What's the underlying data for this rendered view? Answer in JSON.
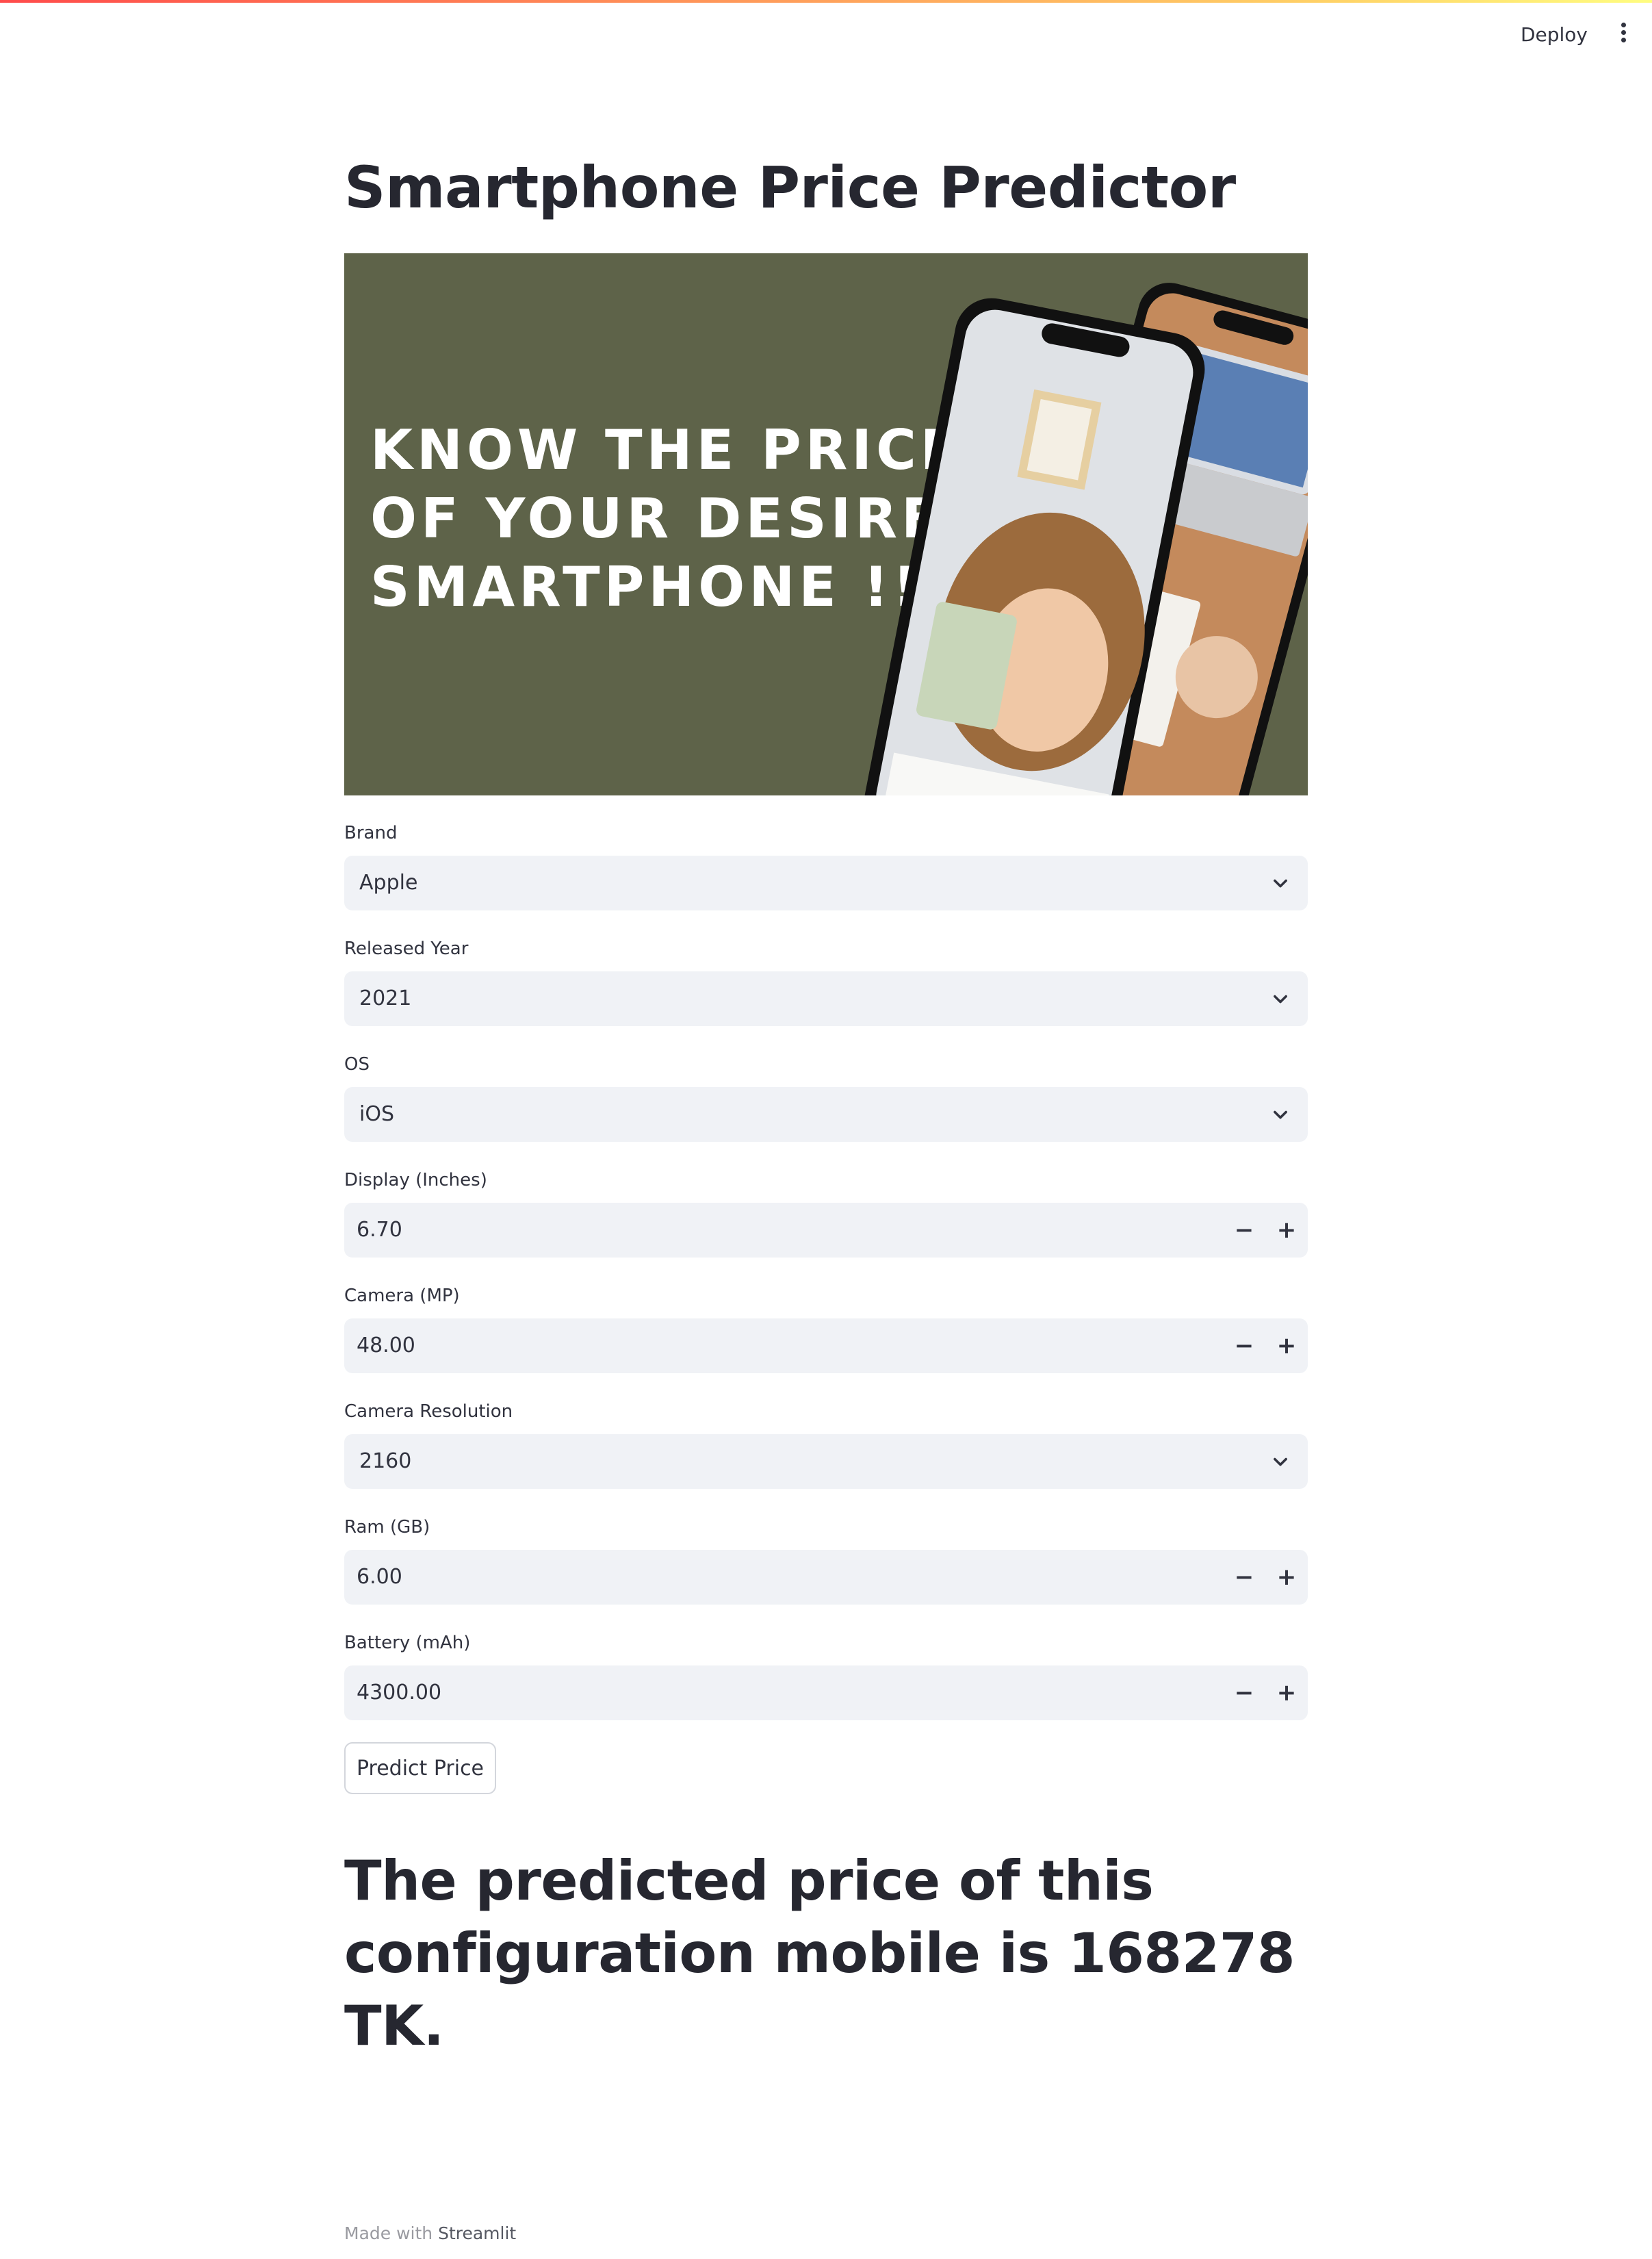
{
  "header": {
    "deploy_label": "Deploy",
    "menu_icon": "vertical-dots-icon"
  },
  "page": {
    "title": "Smartphone Price Predictor"
  },
  "banner": {
    "line1": "KNOW THE PRICE",
    "line2": "OF YOUR DESIRED",
    "line3": "SMARTPHONE !!",
    "background_color": "#5e6349"
  },
  "form": {
    "brand": {
      "label": "Brand",
      "value": "Apple"
    },
    "released_year": {
      "label": "Released Year",
      "value": "2021"
    },
    "os": {
      "label": "OS",
      "value": "iOS"
    },
    "display": {
      "label": "Display (Inches)",
      "value": "6.70",
      "minus": "−",
      "plus": "+"
    },
    "camera_mp": {
      "label": "Camera (MP)",
      "value": "48.00",
      "minus": "−",
      "plus": "+"
    },
    "camera_resolution": {
      "label": "Camera Resolution",
      "value": "2160"
    },
    "ram": {
      "label": "Ram (GB)",
      "value": "6.00",
      "minus": "−",
      "plus": "+"
    },
    "battery": {
      "label": "Battery (mAh)",
      "value": "4300.00",
      "minus": "−",
      "plus": "+"
    },
    "predict_label": "Predict Price"
  },
  "result": {
    "text": "The predicted price of this configuration mobile is 168278 TK."
  },
  "footer": {
    "prefix": "Made with ",
    "link": "Streamlit"
  },
  "colors": {
    "accent_gradient_start": "#ff4b4b",
    "accent_gradient_end": "#fffd80",
    "input_background": "#f0f2f6",
    "text": "#31333f"
  }
}
